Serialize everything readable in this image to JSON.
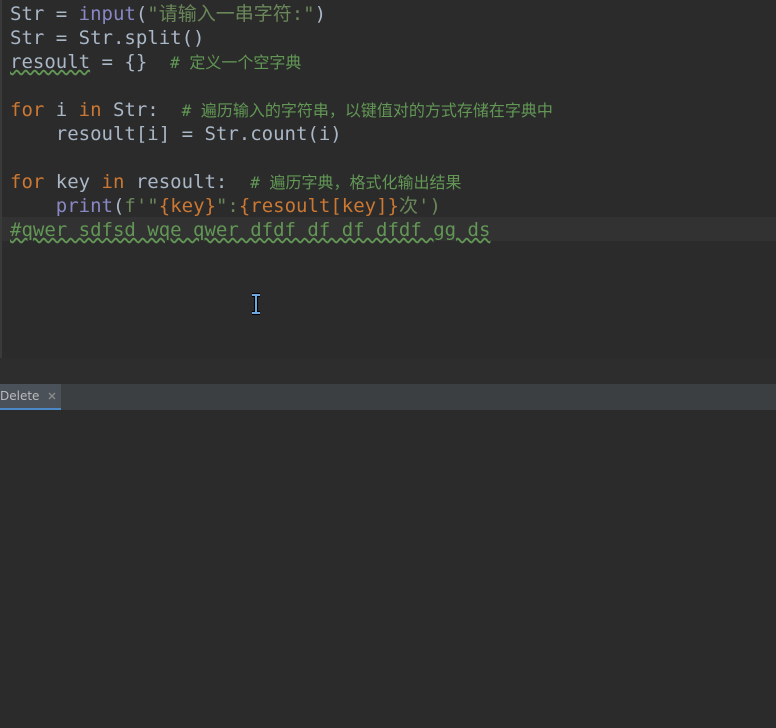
{
  "editor": {
    "lines": [
      {
        "parts": [
          "Str = ",
          "input",
          "(",
          "\"请输入一串字符:\"",
          ")"
        ]
      },
      {
        "parts": [
          "Str = Str.split()"
        ]
      },
      {
        "parts": [
          "resoult",
          " = {}  ",
          "# 定义一个空字典"
        ]
      },
      {
        "parts": [
          ""
        ]
      },
      {
        "parts": [
          "for",
          " i ",
          "in",
          " Str:  ",
          "# 遍历输入的字符串，以键值对的方式存储在字典中"
        ]
      },
      {
        "parts": [
          "    resoult[i] = Str.count(i)"
        ]
      },
      {
        "parts": [
          ""
        ]
      },
      {
        "parts": [
          "for",
          " key ",
          "in",
          " resoult:  ",
          "# 遍历字典，格式化输出结果"
        ]
      },
      {
        "parts": [
          "    ",
          "print",
          "(",
          "f'\"",
          "{key}",
          "\":",
          "{resoult[key]}",
          "次')"
        ]
      },
      {
        "parts": [
          "#qwer sdfsd wqe qwer dfdf df df dfdf gg ds"
        ]
      }
    ]
  },
  "bottom_panel": {
    "tab_label": "Delete",
    "close_icon": "close-icon"
  },
  "colors": {
    "background": "#2b2b2b",
    "keyword": "#cc7832",
    "builtin": "#8888c6",
    "string": "#6a8759",
    "comment": "#629755",
    "text": "#a9b7c6",
    "tab_accent": "#4a88c7"
  }
}
